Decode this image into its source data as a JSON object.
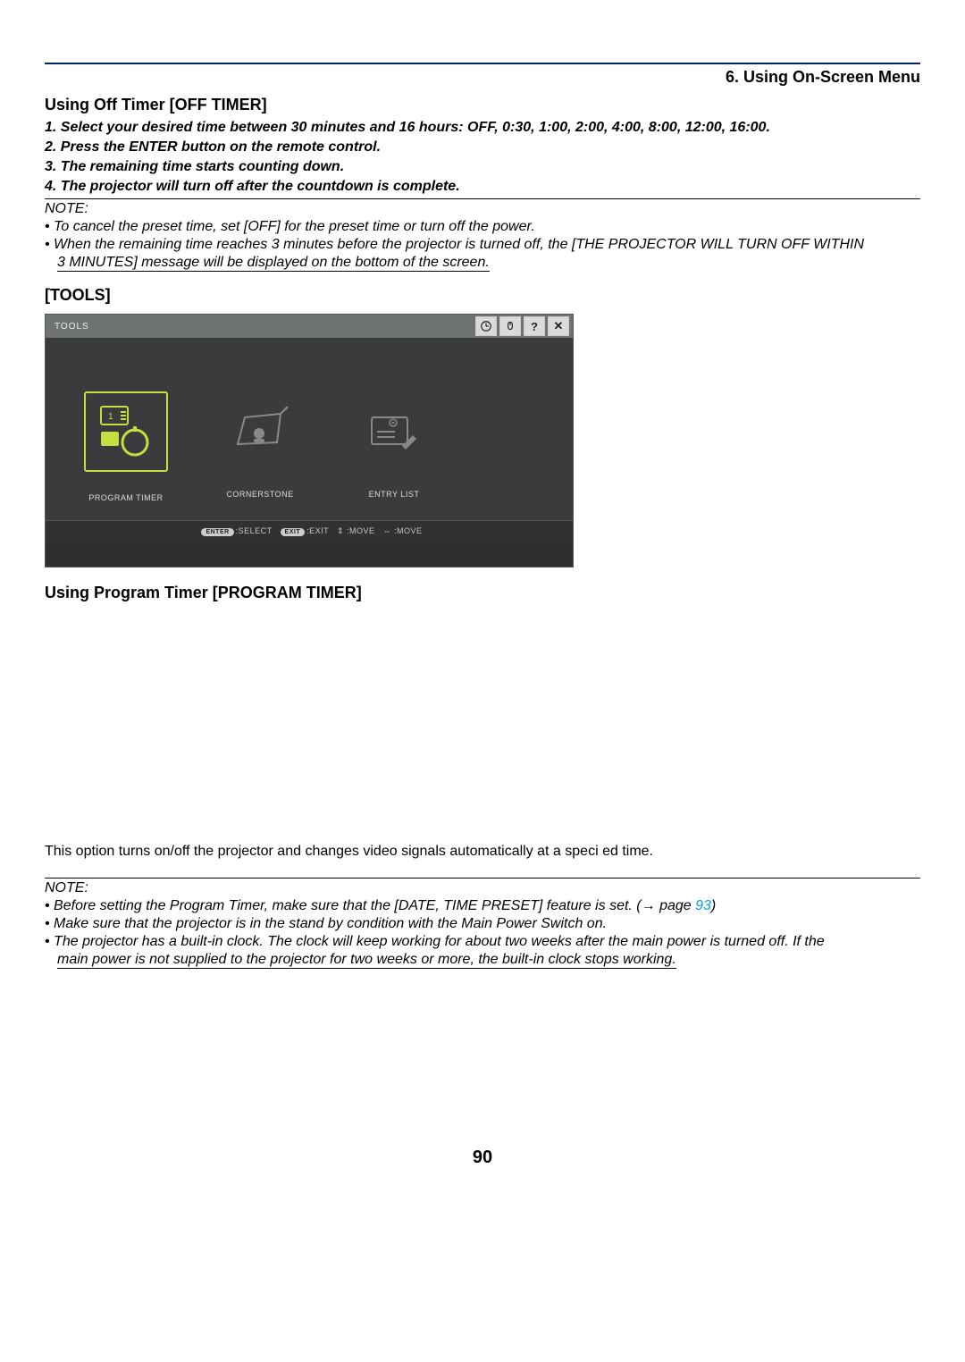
{
  "chapter": "6. Using On-Screen Menu",
  "off_timer": {
    "heading": "Using Off Timer [OFF TIMER]",
    "step1": "1.  Select your desired time between 30 minutes and 16 hours: OFF, 0:30, 1:00, 2:00, 4:00, 8:00, 12:00, 16:00.",
    "step2": "2.  Press the ENTER button on the remote control.",
    "step3": "3.  The remaining time starts counting down.",
    "step4": "4.  The projector will turn off after the countdown is complete.",
    "note_label": "NOTE:",
    "note1": "•  To cancel the preset time, set [OFF] for the preset time or turn off the power.",
    "note2": "•  When the remaining time reaches 3 minutes before the projector is turned off, the [THE PROJECTOR WILL TURN OFF WITHIN",
    "note2b": "3 MINUTES] message will be displayed on the bottom of the screen."
  },
  "tools": {
    "heading": "[TOOLS]",
    "ui_title": "TOOLS",
    "items": {
      "program_timer": "PROGRAM TIMER",
      "cornerstone": "CORNERSTONE",
      "entry_list": "ENTRY LIST"
    },
    "footer": {
      "enter": "ENTER",
      "select": ":SELECT",
      "exit_btn": "EXIT",
      "exit": ":EXIT",
      "move1": "⇕ :MOVE",
      "move2": "⇔ :MOVE"
    }
  },
  "program_timer": {
    "heading": "Using Program Timer [PROGRAM TIMER]",
    "desc": "This option turns on/off the projector and changes video signals automatically at a speci ed time.",
    "note_label": "NOTE:",
    "note1a": "•  Before setting the Program Timer, make sure that the [DATE, TIME PRESET] feature is set. (→ page ",
    "note1_link": "93",
    "note1b": ")",
    "note2": "•  Make sure that the projector is in the stand by condition with the Main Power Switch on.",
    "note3": "•  The projector has a built-in clock. The clock will keep working for about two weeks after the main power is turned off. If the",
    "note3b": "main power is not supplied to the projector for two weeks or more, the built-in clock stops working."
  },
  "page_number": "90"
}
